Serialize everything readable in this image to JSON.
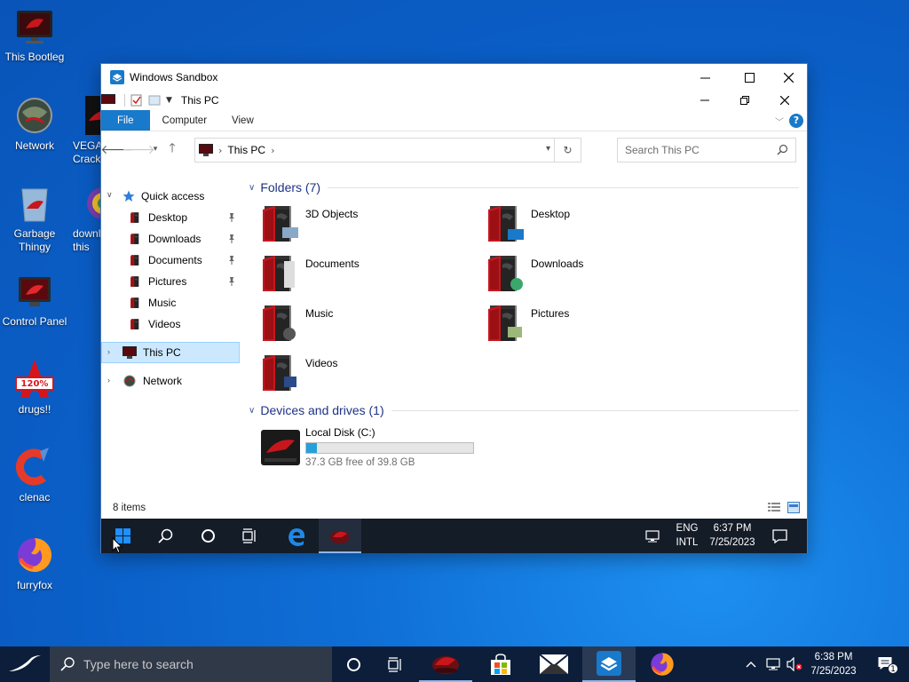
{
  "desktop": {
    "icons": [
      {
        "label": "This Bootleg"
      },
      {
        "label": "Network"
      },
      {
        "label": "VEGA Crack"
      },
      {
        "label": "Garbage Thingy"
      },
      {
        "label": "download this"
      },
      {
        "label": "Control Panel"
      },
      {
        "label": "drugs!!"
      },
      {
        "label": "clenac"
      },
      {
        "label": "furryfox"
      }
    ],
    "drugs_badge": "120%"
  },
  "sandbox": {
    "title": "Windows Sandbox"
  },
  "explorer": {
    "title": "This PC",
    "ribbon_tabs": [
      "File",
      "Computer",
      "View"
    ],
    "help": "?",
    "address": {
      "crumb": "This PC"
    },
    "search": {
      "placeholder": "Search This PC"
    },
    "nav": {
      "quick_access": "Quick access",
      "items": [
        "Desktop",
        "Downloads",
        "Documents",
        "Pictures",
        "Music",
        "Videos"
      ],
      "this_pc": "This PC",
      "network": "Network"
    },
    "folders_header": "Folders (7)",
    "folders": [
      "3D Objects",
      "Desktop",
      "Documents",
      "Downloads",
      "Music",
      "Pictures",
      "Videos"
    ],
    "devices_header": "Devices and drives (1)",
    "drive": {
      "name": "Local Disk (C:)",
      "free": "37.3 GB free of 39.8 GB",
      "used_fraction": 0.063
    },
    "status": "8 items"
  },
  "inner_taskbar": {
    "lang1": "ENG",
    "lang2": "INTL",
    "time": "6:37 PM",
    "date": "7/25/2023"
  },
  "taskbar": {
    "search_placeholder": "Type here to search",
    "time": "6:38 PM",
    "date": "7/25/2023",
    "notification_count": "1"
  },
  "colors": {
    "accent": "#1979ca",
    "desktop_bg": "#0a5ec6",
    "taskbar_bg": "#0c1e3a",
    "folder_red": "#c8161d"
  }
}
